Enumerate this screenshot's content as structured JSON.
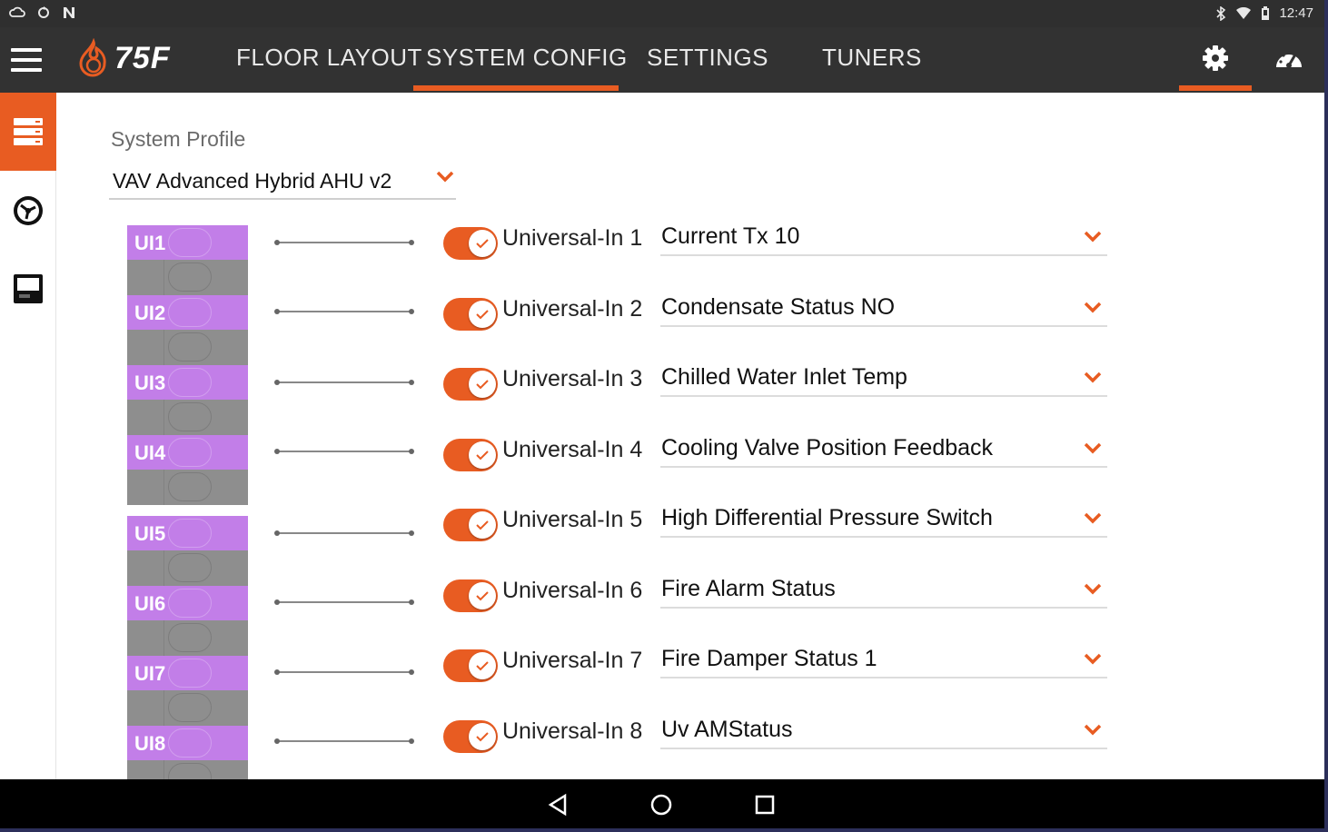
{
  "status_bar": {
    "left_icons": [
      "cloud-icon",
      "sync-icon",
      "n-icon"
    ],
    "right_icons": [
      "bluetooth-icon",
      "wifi-icon",
      "battery-icon"
    ],
    "time": "12:47"
  },
  "app_bar": {
    "logo_text": "75F",
    "tabs": [
      {
        "label": "FLOOR LAYOUT",
        "active": false
      },
      {
        "label": "SYSTEM CONFIG",
        "active": true
      },
      {
        "label": "SETTINGS",
        "active": false
      },
      {
        "label": "TUNERS",
        "active": false
      }
    ],
    "accent": "#e85c22"
  },
  "sidebar": {
    "items": [
      {
        "icon": "server-stack-icon",
        "active": true
      },
      {
        "icon": "fan-dial-icon",
        "active": false
      },
      {
        "icon": "rtu-device-icon",
        "active": false
      }
    ]
  },
  "system_profile": {
    "label": "System Profile",
    "value": "VAV Advanced Hybrid AHU v2"
  },
  "inputs": [
    {
      "port": "UI1",
      "label": "Universal-In 1",
      "value": "Current Tx 10",
      "enabled": true
    },
    {
      "port": "UI2",
      "label": "Universal-In 2",
      "value": "Condensate Status NO",
      "enabled": true
    },
    {
      "port": "UI3",
      "label": "Universal-In 3",
      "value": "Chilled Water Inlet Temp",
      "enabled": true
    },
    {
      "port": "UI4",
      "label": "Universal-In 4",
      "value": "Cooling Valve Position Feedback",
      "enabled": true
    },
    {
      "port": "UI5",
      "label": "Universal-In 5",
      "value": "High Differential Pressure Switch",
      "enabled": true
    },
    {
      "port": "UI6",
      "label": "Universal-In 6",
      "value": "Fire Alarm Status",
      "enabled": true
    },
    {
      "port": "UI7",
      "label": "Universal-In 7",
      "value": "Fire Damper Status 1",
      "enabled": true
    },
    {
      "port": "UI8",
      "label": "Universal-In 8",
      "value": "Uv AMStatus",
      "enabled": true
    }
  ],
  "nav_bar": {
    "buttons": [
      "back-icon",
      "home-icon",
      "recents-icon"
    ]
  }
}
